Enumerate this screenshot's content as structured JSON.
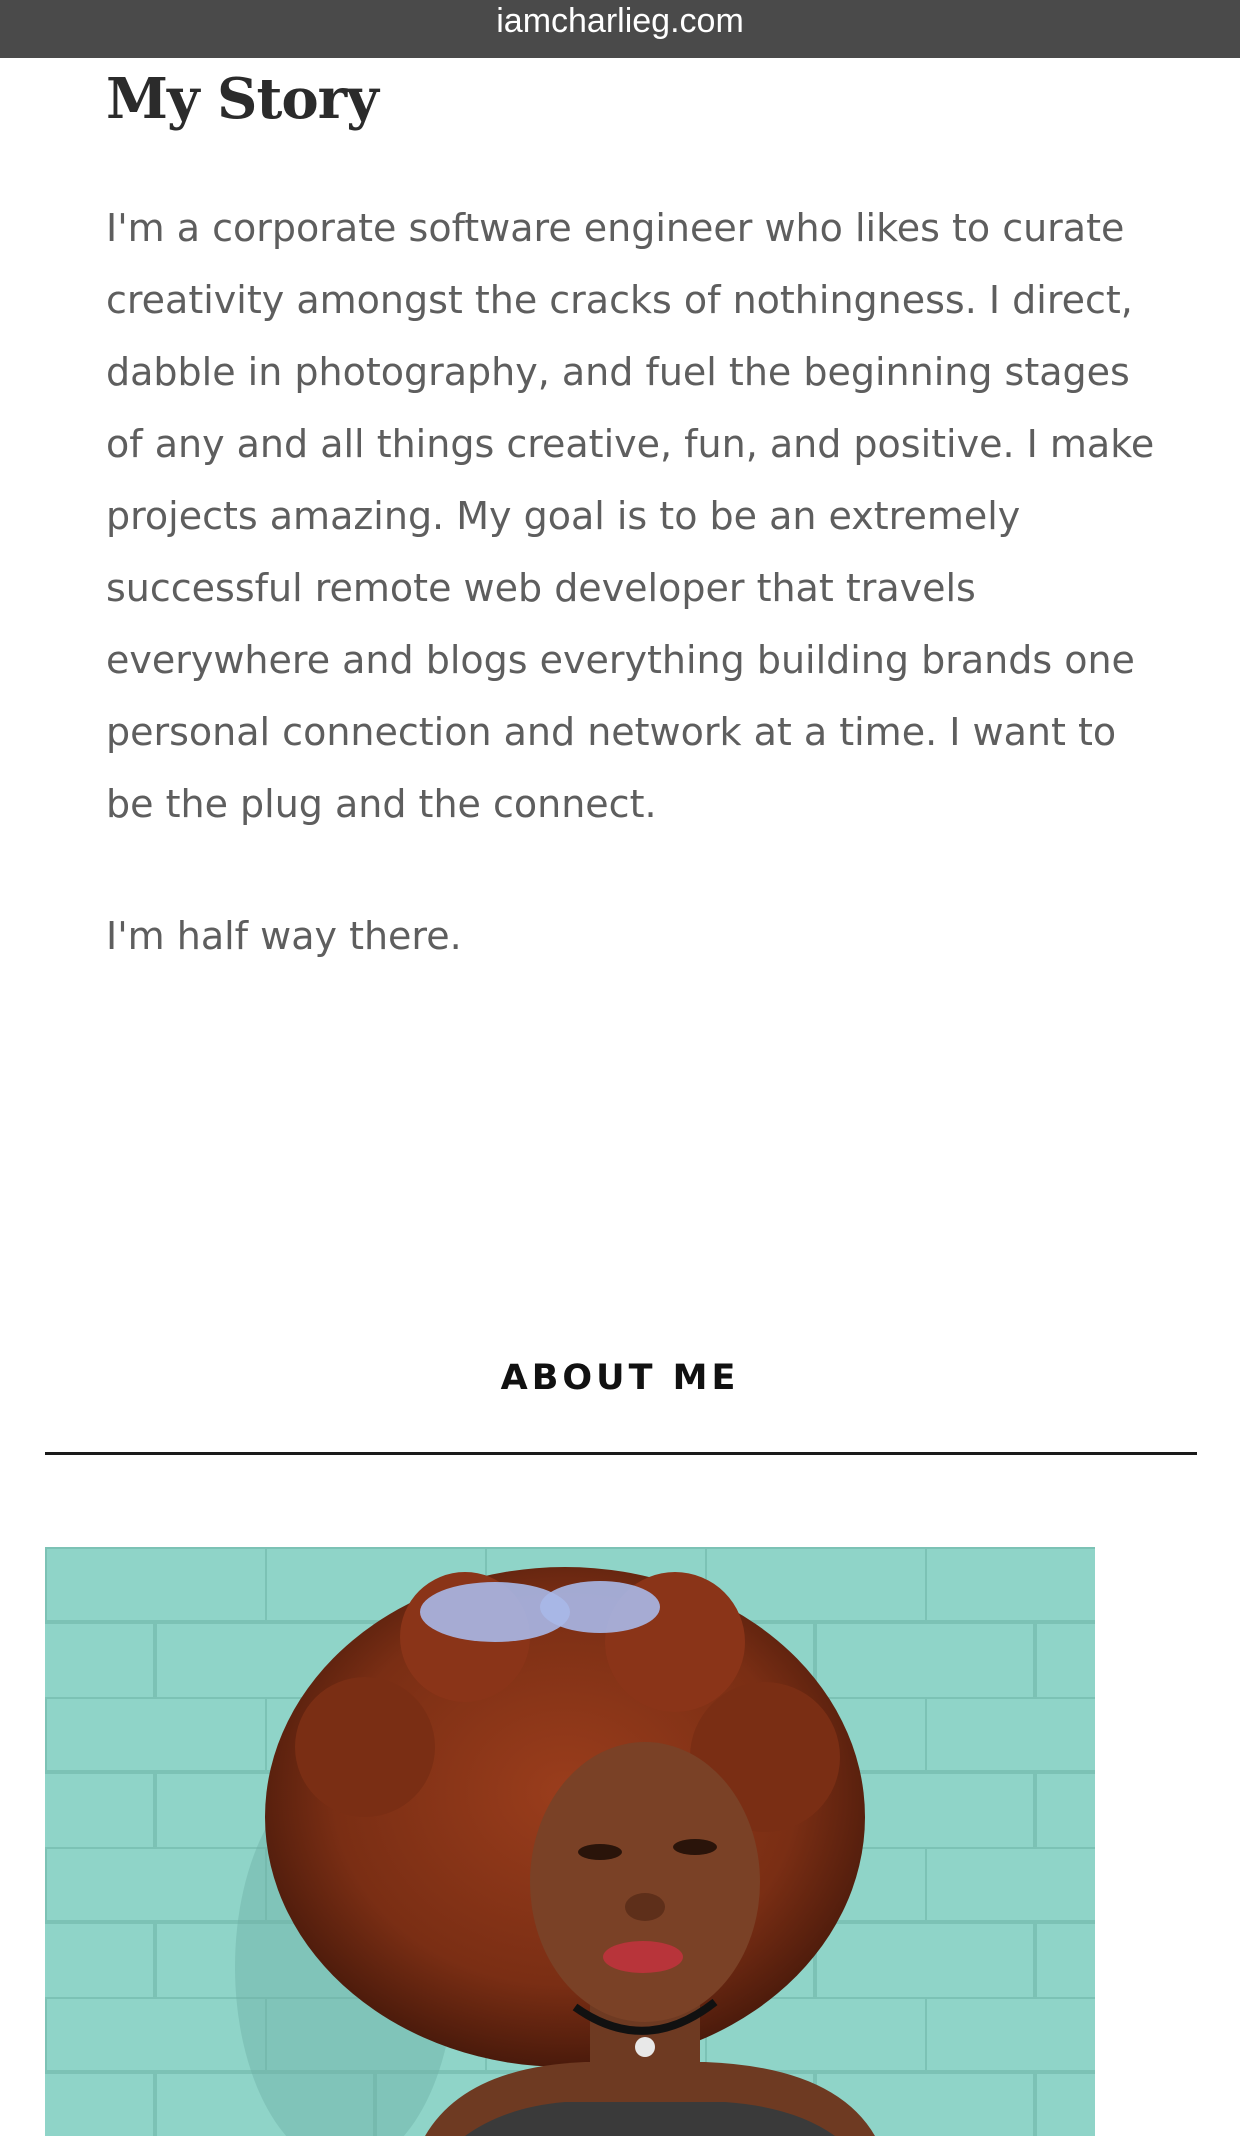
{
  "browser": {
    "url": "iamcharlieg.com"
  },
  "story": {
    "title": "My Story",
    "paragraph": "I'm a corporate software engineer who likes to curate creativity amongst the cracks of nothingness. I direct, dabble in photography, and fuel the beginning stages of any and all things creative, fun, and positive. I make projects amazing. My goal is to be an extremely successful remote web developer that travels everywhere and blogs everything building brands one personal connection and network at a time. I want to be the plug and the connect.",
    "follow_up": "I'm half way there."
  },
  "about": {
    "heading": "ABOUT ME"
  },
  "colors": {
    "url_bar": "#4a4a4a",
    "wall_teal": "#8fd4c8",
    "hair": "#7a2e14",
    "body_text": "#5e5e5e"
  }
}
